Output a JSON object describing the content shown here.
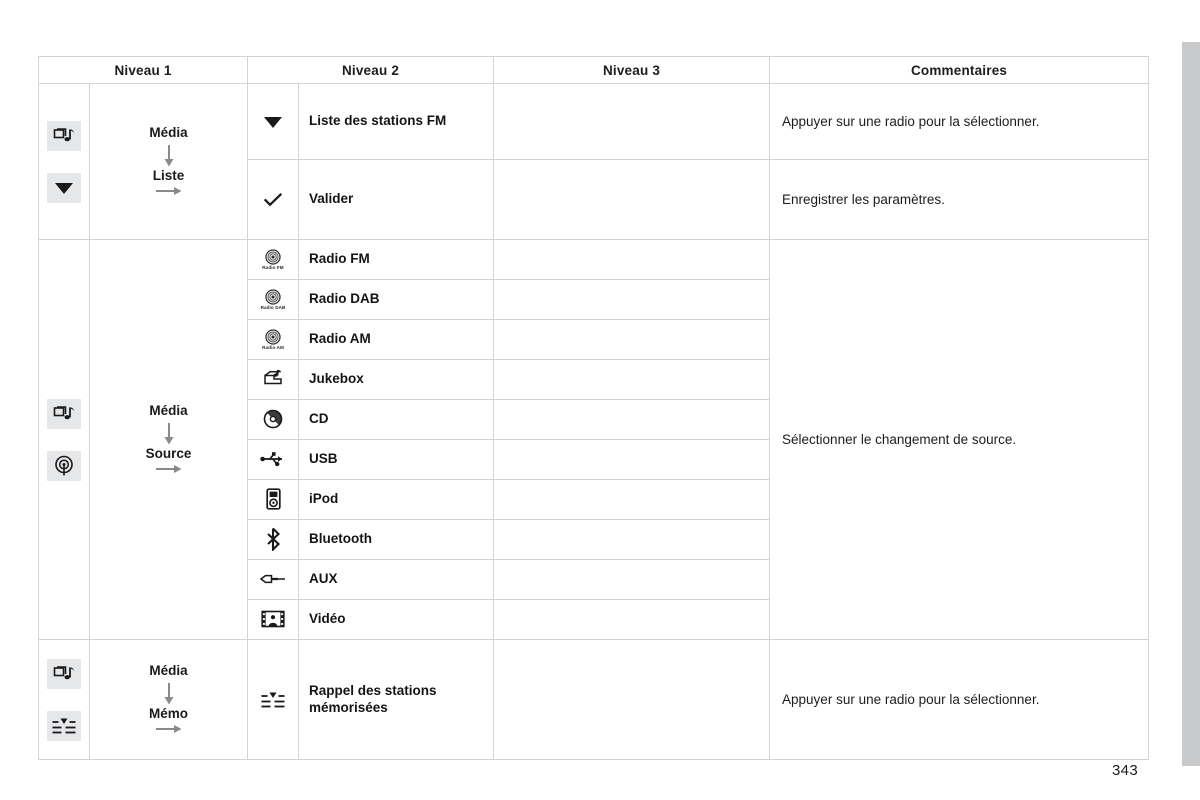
{
  "page": {
    "number": "343"
  },
  "table": {
    "headers": [
      "Niveau 1",
      "Niveau 2",
      "Niveau 3",
      "Commentaires"
    ],
    "groups": [
      {
        "id": "media-liste",
        "icons": [
          "media-icon",
          "down-triangle-icon"
        ],
        "level1": {
          "first": "Média",
          "second": "Liste"
        },
        "rows": [
          {
            "icon": "down-triangle-icon",
            "level2": "Liste des stations FM",
            "level3": "",
            "comment": "Appuyer sur une radio pour la sélectionner.",
            "icon_cell_shade": "white",
            "comment_shade": "gray"
          },
          {
            "icon": "check-icon",
            "level2": "Valider",
            "level3": "",
            "comment": "Enregistrer les paramètres.",
            "icon_cell_shade": "gray",
            "comment_shade": "white"
          }
        ]
      },
      {
        "id": "media-source",
        "icons": [
          "media-icon",
          "source-antenna-icon"
        ],
        "level1": {
          "first": "Média",
          "second": "Source"
        },
        "comment": "Sélectionner le changement de source.",
        "comment_shade": "gray",
        "rows": [
          {
            "icon": "radio-fm-icon",
            "sublabel": "Radio FM",
            "level2": "Radio FM",
            "level3": ""
          },
          {
            "icon": "radio-dab-icon",
            "sublabel": "Radio DAB",
            "level2": "Radio DAB",
            "level3": ""
          },
          {
            "icon": "radio-am-icon",
            "sublabel": "Radio AM",
            "level2": "Radio AM",
            "level3": ""
          },
          {
            "icon": "jukebox-icon",
            "sublabel": "",
            "level2": "Jukebox",
            "level3": ""
          },
          {
            "icon": "cd-icon",
            "sublabel": "",
            "level2": "CD",
            "level3": ""
          },
          {
            "icon": "usb-icon",
            "sublabel": "",
            "level2": "USB",
            "level3": ""
          },
          {
            "icon": "ipod-icon",
            "sublabel": "",
            "level2": "iPod",
            "level3": ""
          },
          {
            "icon": "bluetooth-icon",
            "sublabel": "",
            "level2": "Bluetooth",
            "level3": ""
          },
          {
            "icon": "aux-jack-icon",
            "sublabel": "",
            "level2": "AUX",
            "level3": ""
          },
          {
            "icon": "video-icon",
            "sublabel": "",
            "level2": "Vidéo",
            "level3": ""
          }
        ]
      },
      {
        "id": "media-memo",
        "icons": [
          "media-icon",
          "presets-icon"
        ],
        "level1": {
          "first": "Média",
          "second": "Mémo"
        },
        "rows": [
          {
            "icon": "presets-icon",
            "level2": "Rappel des stations mémorisées",
            "level3": "",
            "comment": "Appuyer sur une radio pour la sélectionner.",
            "icon_cell_shade": "white",
            "comment_shade": "gray"
          }
        ]
      }
    ]
  },
  "colors": {
    "header_bg": "#e4e5e7",
    "shade_bg": "#e1e3e5",
    "border": "#d2d4d6",
    "edge_bar": "#c7c9ca",
    "text": "#1a1a1a"
  }
}
